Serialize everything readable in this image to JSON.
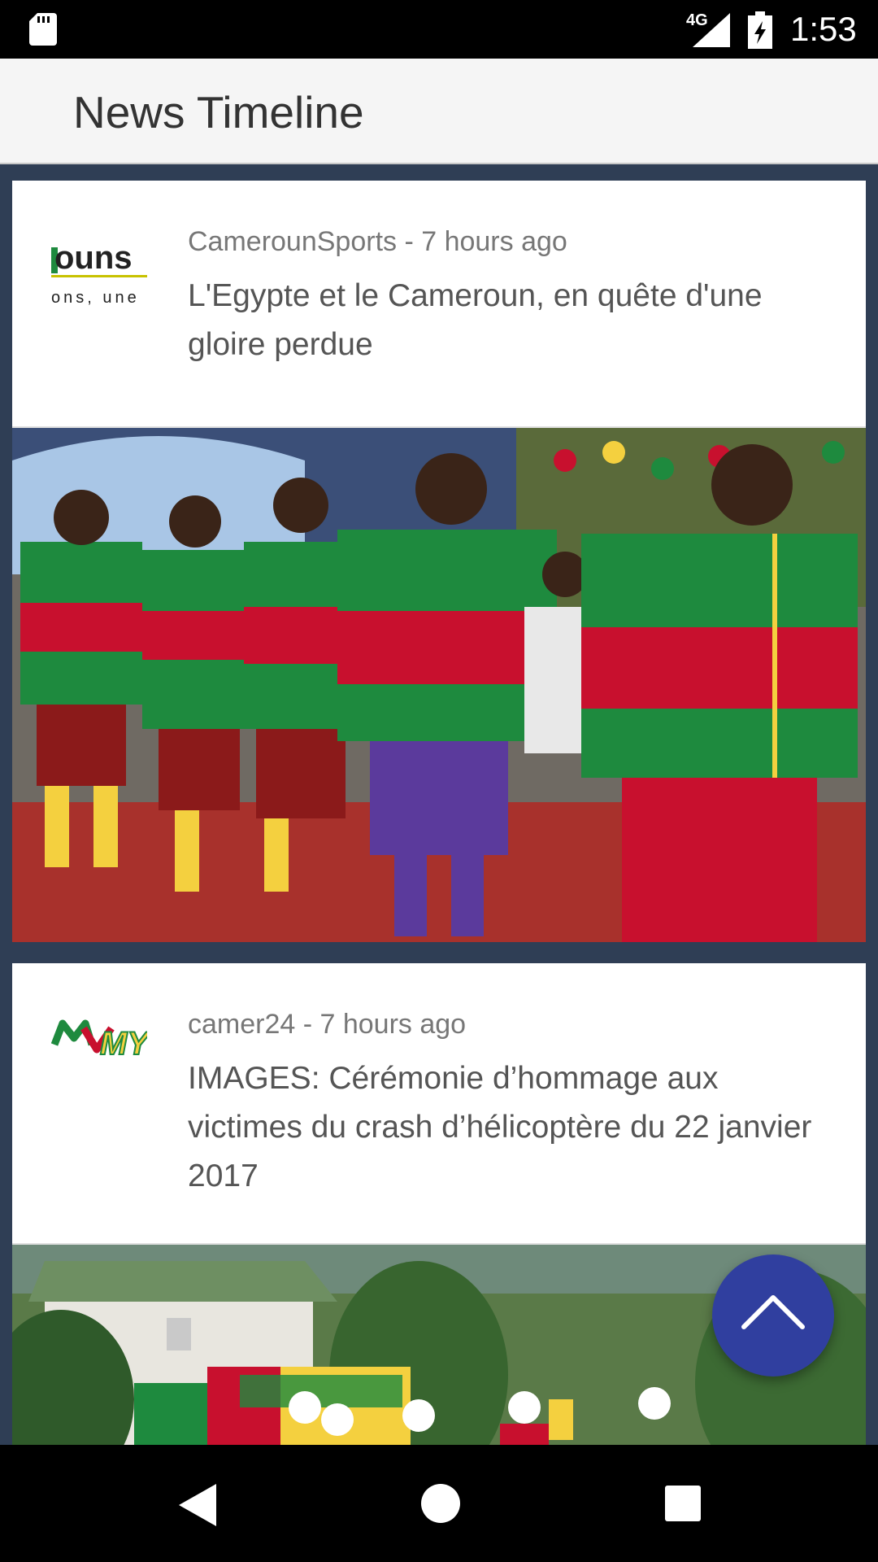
{
  "status_bar": {
    "network": "4G",
    "time": "1:53",
    "icons": [
      "sd-card-icon",
      "signal-icon",
      "battery-charging-icon"
    ]
  },
  "app_bar": {
    "title": "News Timeline"
  },
  "feed": {
    "items": [
      {
        "source": "CamerounSports",
        "time_ago": "7 hours ago",
        "meta": "CamerounSports - 7 hours ago",
        "headline": "L'Egypte et le Cameroun, en quête d'une gloire perdue",
        "logo_text_top": "ouns",
        "logo_text_bottom": "ons, une",
        "image": "cameroon-team-photo"
      },
      {
        "source": "camer24",
        "time_ago": "7 hours ago",
        "meta": "camer24 - 7 hours ago",
        "headline": "IMAGES: Cérémonie d’hommage aux victimes du crash d’hélicoptère du 22 janvier 2017",
        "logo_text": "MY24",
        "image": "ceremony-photo"
      }
    ]
  },
  "fab": {
    "icon": "chevron-up-icon",
    "color": "#303f9f"
  },
  "nav_bar": {
    "icons": [
      "back-icon",
      "home-icon",
      "recents-icon"
    ]
  },
  "colors": {
    "feed_background": "#2f3e55",
    "status_bar": "#000000",
    "app_bar": "#f5f5f5",
    "cameroon_green": "#1e8a3e",
    "cameroon_red": "#c8102e",
    "cameroon_yellow": "#f4d03f"
  }
}
